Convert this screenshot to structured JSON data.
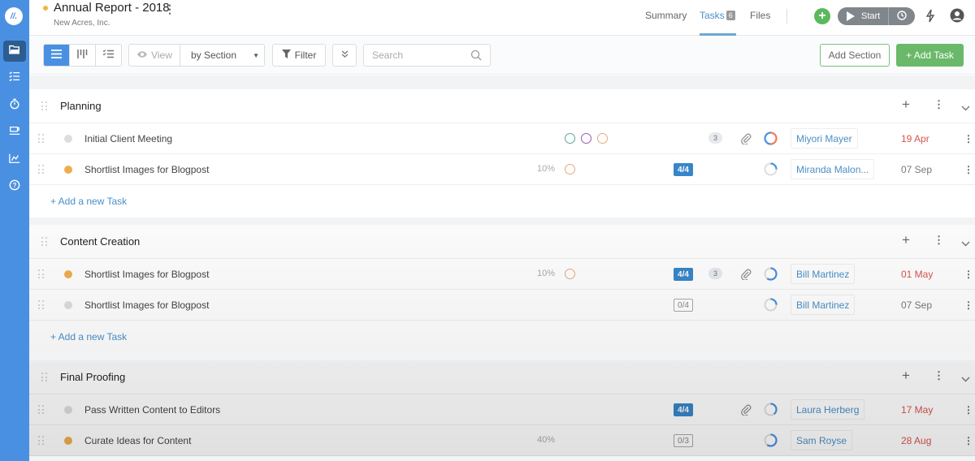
{
  "header": {
    "title": "Annual Report - 2018",
    "subtitle": "New Acres, Inc.",
    "title_dot_color": "#f0b43c",
    "tabs": [
      {
        "label": "Summary",
        "active": false
      },
      {
        "label": "Tasks",
        "badge": "6",
        "active": true
      },
      {
        "label": "Files",
        "active": false
      }
    ],
    "start_label": "Start"
  },
  "sidebar": {
    "logo": "//.",
    "items": [
      {
        "icon": "folder-icon",
        "active": true
      },
      {
        "icon": "task-list-icon",
        "active": false
      },
      {
        "icon": "stopwatch-icon",
        "active": false
      },
      {
        "icon": "coffee-cup-icon",
        "active": false
      },
      {
        "icon": "chart-icon",
        "active": false
      },
      {
        "icon": "help-icon",
        "active": false
      }
    ]
  },
  "toolbar": {
    "view_label": "View",
    "view_by": "by Section",
    "filter_label": "Filter",
    "search_placeholder": "Search",
    "add_section_label": "Add Section",
    "add_task_label": "+ Add Task"
  },
  "colors": {
    "accent": "#4a90e2",
    "green": "#6ab96a",
    "overdue": "#d9534f",
    "dot_orange": "#f0ad4e",
    "dot_grey": "#dddddd"
  },
  "add_task_link": "+ Add a new Task",
  "sections": [
    {
      "title": "Planning",
      "tasks": [
        {
          "name": "Initial Client Meeting",
          "status": "grey",
          "percent": "",
          "rings": [
            "#5aa39c",
            "#9b59b6",
            "#e8a87c"
          ],
          "subtasks": "",
          "comments": "3",
          "attachment": true,
          "progress": "mixed",
          "assignee": "Miyori Mayer",
          "due": "19 Apr",
          "overdue": true
        },
        {
          "name": "Shortlist Images for Blogpost",
          "status": "orange",
          "percent": "10%",
          "rings": [
            "#e8a87c"
          ],
          "subtasks": "4/4",
          "subtasks_done": true,
          "comments": "",
          "attachment": false,
          "progress": "low",
          "assignee": "Miranda Malon...",
          "due": "07 Sep",
          "overdue": false
        }
      ]
    },
    {
      "title": "Content Creation",
      "tasks": [
        {
          "name": "Shortlist Images for Blogpost",
          "status": "orange",
          "percent": "10%",
          "rings": [
            "#e8a87c"
          ],
          "subtasks": "4/4",
          "subtasks_done": true,
          "comments": "3",
          "attachment": true,
          "progress": "high",
          "assignee": "Bill Martinez",
          "due": "01 May",
          "overdue": true
        },
        {
          "name": "Shortlist Images for Blogpost",
          "status": "grey",
          "percent": "",
          "rings": [],
          "subtasks": "0/4",
          "subtasks_done": false,
          "comments": "",
          "attachment": false,
          "progress": "low",
          "assignee": "Bill Martinez",
          "due": "07 Sep",
          "overdue": false
        }
      ]
    },
    {
      "title": "Final Proofing",
      "tasks": [
        {
          "name": "Pass Written Content to Editors",
          "status": "grey",
          "percent": "",
          "rings": [],
          "subtasks": "4/4",
          "subtasks_done": true,
          "comments": "",
          "attachment": true,
          "progress": "mid",
          "assignee": "Laura Herberg",
          "due": "17 May",
          "overdue": true
        },
        {
          "name": "Curate Ideas for Content",
          "status": "orange",
          "percent": "40%",
          "rings": [],
          "subtasks": "0/3",
          "subtasks_done": false,
          "comments": "",
          "attachment": false,
          "progress": "high",
          "assignee": "Sam Royse",
          "due": "28 Aug",
          "overdue": true
        }
      ]
    }
  ]
}
